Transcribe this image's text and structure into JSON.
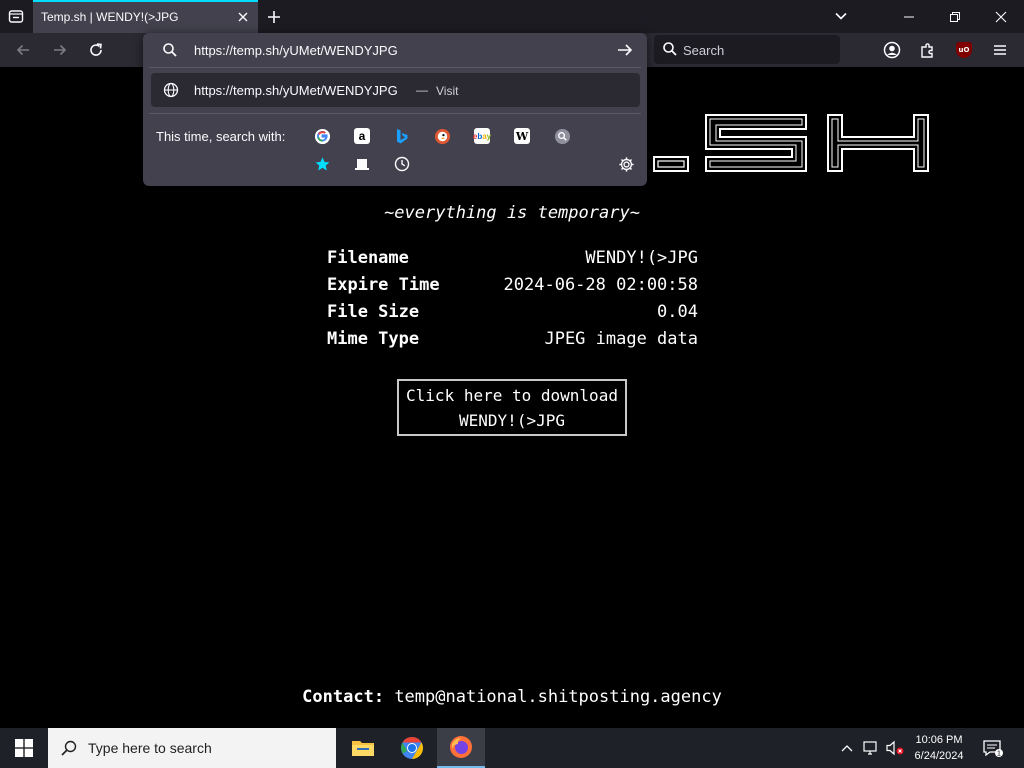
{
  "browser": {
    "tab_title": "Temp.sh | WENDY!(>JPG",
    "search_placeholder": "Search"
  },
  "urlbar": {
    "value": "https://temp.sh/yUMet/WENDYJPG",
    "result_url": "https://temp.sh/yUMet/WENDYJPG",
    "result_separator": "—",
    "result_action": "Visit",
    "search_with_label": "This time, search with:",
    "engines": [
      "google-icon",
      "amazon-icon",
      "bing-icon",
      "duckduckgo-icon",
      "ebay-icon",
      "wikipedia-icon",
      "search-engine-icon",
      "bookmarks-icon",
      "tabs-icon",
      "history-icon"
    ]
  },
  "page": {
    "logo_text": ".SH",
    "tagline": "~everything is temporary~",
    "info": [
      {
        "key": "Filename",
        "value": "WENDY!(>JPG"
      },
      {
        "key": "Expire Time",
        "value": "2024-06-28 02:00:58"
      },
      {
        "key": "File Size",
        "value": "0.04"
      },
      {
        "key": "Mime Type",
        "value": "JPEG image data"
      }
    ],
    "download_line1": "Click here to download",
    "download_line2": "WENDY!(>JPG",
    "contact_label": "Contact:",
    "contact_email": "temp@national.shitposting.agency"
  },
  "taskbar": {
    "search_placeholder": "Type here to search",
    "time": "10:06 PM",
    "date": "6/24/2024",
    "notification_count": "1"
  },
  "colors": {
    "accent": "#00ddff",
    "tab_active": "#42414d",
    "toolbar": "#2b2a33",
    "page_bg": "#000000"
  }
}
